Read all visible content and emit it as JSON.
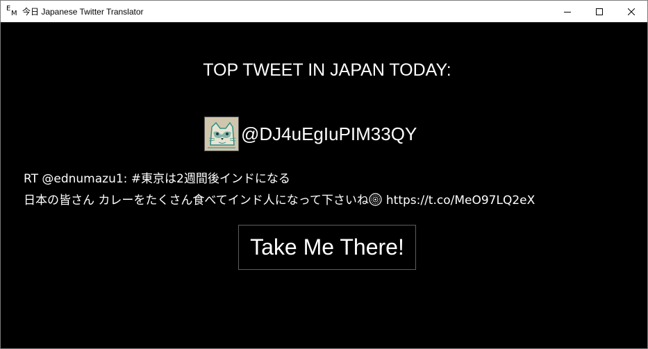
{
  "window": {
    "icon_letters": [
      "E",
      "M"
    ],
    "title": "今日 Japanese Twitter Translator",
    "controls": [
      "minimize",
      "maximize",
      "close"
    ]
  },
  "main": {
    "heading": "TOP TWEET IN JAPAN TODAY:",
    "user": {
      "avatar_icon": "raccoon-sketch-avatar",
      "handle": "@DJ4uEgIuPIM33QY"
    },
    "tweet": {
      "line1": "RT @ednumazu1: #東京は2週間後インドになる",
      "line2_text": "日本の皆さん カレーをたくさん食べてインド人になって下さいね",
      "emoji_icon": "cd-disc-emoji",
      "line2_link": "https://t.co/MeO97LQ2eX"
    },
    "action_button": "Take Me There!"
  },
  "colors": {
    "background": "#000000",
    "text": "#ffffff",
    "titlebar": "#ffffff",
    "button_border": "#5e5e5e"
  }
}
